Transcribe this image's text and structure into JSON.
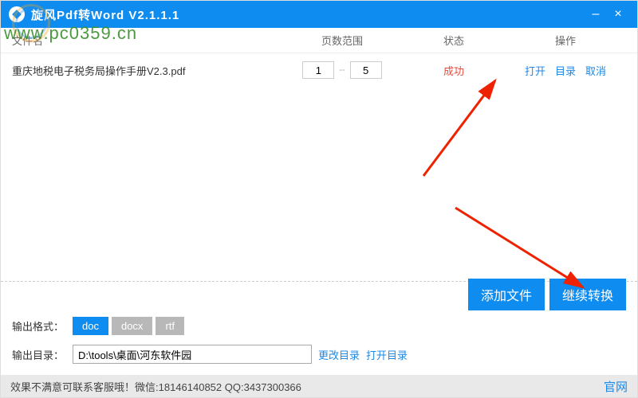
{
  "titlebar": {
    "title": "旋风Pdf转Word  V2.1.1.1"
  },
  "watermark": "www.pc0359.cn",
  "header": {
    "file": "文件名",
    "range": "页数范围",
    "status": "状态",
    "ops": "操作"
  },
  "row": {
    "filename": "重庆地税电子税务局操作手册V2.3.pdf",
    "page_from": "1",
    "page_to": "5",
    "range_sep": "--",
    "status": "成功",
    "open": "打开",
    "dir": "目录",
    "cancel": "取消"
  },
  "actions": {
    "add_file": "添加文件",
    "continue": "继续转换"
  },
  "format": {
    "label": "输出格式：",
    "doc": "doc",
    "docx": "docx",
    "rtf": "rtf"
  },
  "output": {
    "label": "输出目录：",
    "path": "D:\\tools\\桌面\\河东软件园",
    "change": "更改目录",
    "open": "打开目录"
  },
  "statusbar": {
    "text": "效果不满意可联系客服哦！微信:18146140852 QQ:3437300366",
    "site": "官网"
  }
}
